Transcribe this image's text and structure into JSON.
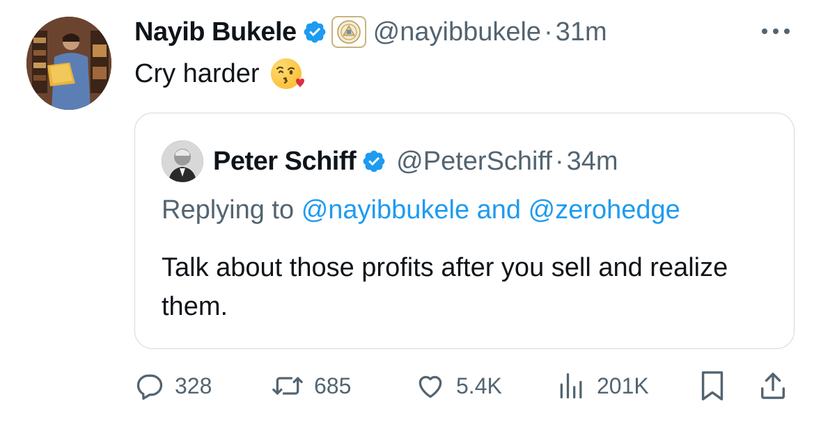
{
  "tweet": {
    "author_name": "Nayib Bukele",
    "handle": "@nayibbukele",
    "separator": "·",
    "time": "31m",
    "text": "Cry harder",
    "emoji_icon": "face-blowing-kiss-icon"
  },
  "quoted": {
    "author_name": "Peter Schiff",
    "handle": "@PeterSchiff",
    "separator": "·",
    "time": "34m",
    "replying_prefix": "Replying to",
    "replying_user1": "@nayibbukele",
    "replying_and": "and",
    "replying_user2": "@zerohedge",
    "text": "Talk about those profits after you sell and realize them."
  },
  "actions": {
    "replies": "328",
    "retweets": "685",
    "likes": "5.4K",
    "views": "201K"
  },
  "colors": {
    "verified": "#1d9bf0",
    "link": "#1d9bf0",
    "secondary_text": "#536471",
    "border": "#cfd9de"
  }
}
